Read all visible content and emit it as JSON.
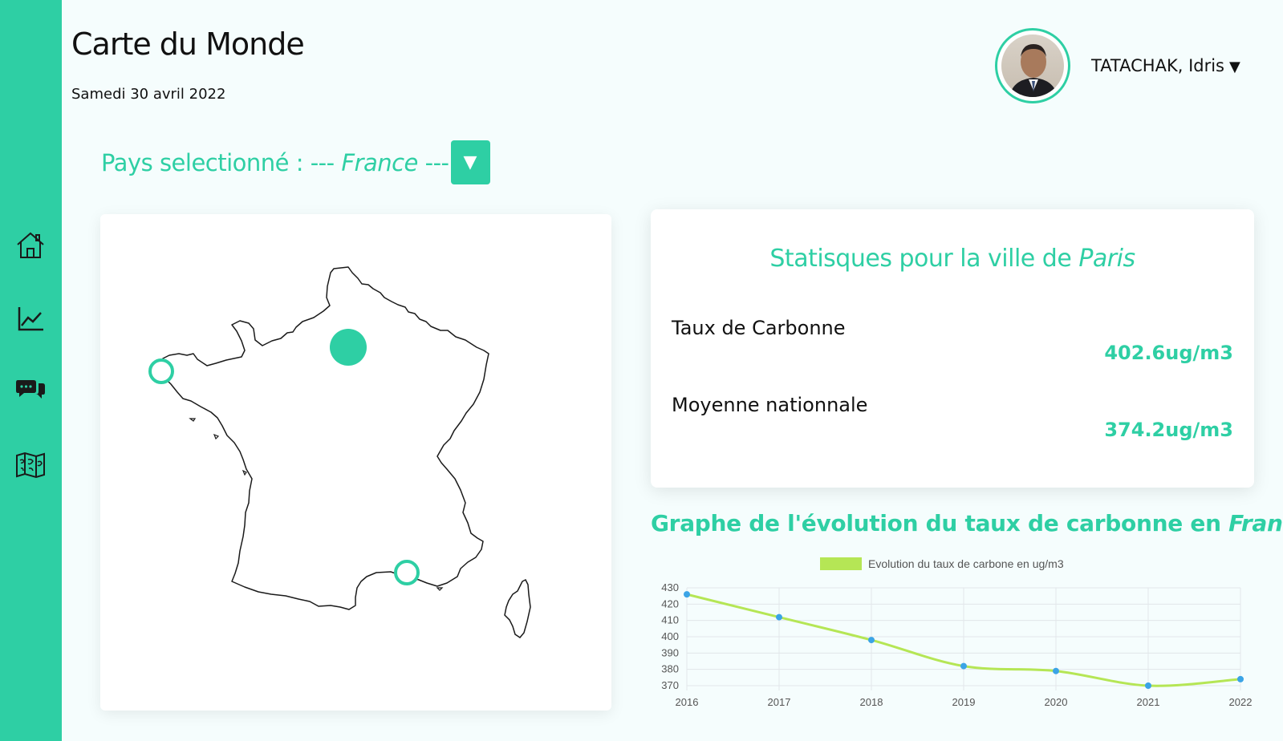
{
  "header": {
    "title": "Carte du Monde",
    "date": "Samedi 30 avril 2022"
  },
  "user": {
    "name": "TATACHAK, Idris",
    "caret": "▼"
  },
  "sidebar": {
    "items": [
      {
        "icon": "home-icon"
      },
      {
        "icon": "chart-line-icon"
      },
      {
        "icon": "chat-icon"
      },
      {
        "icon": "world-map-icon"
      }
    ]
  },
  "country_selector": {
    "label_prefix": "Pays selectionné : --- ",
    "country": "France",
    "label_suffix": " ---",
    "button_glyph": "▼"
  },
  "stats": {
    "title_prefix": "Statisques pour la ville de ",
    "city": "Paris",
    "carbon_label": "Taux de Carbonne",
    "carbon_value": "402.6ug/m3",
    "national_label": "Moyenne nationnale",
    "national_value": "374.2ug/m3"
  },
  "graph": {
    "title_prefix": "Graphe de l'évolution du taux de carbonne en ",
    "country": "France"
  },
  "colors": {
    "accent": "#2ecfa4",
    "line": "#b5e655",
    "point": "#3ba4e6"
  },
  "chart_data": {
    "type": "line",
    "x": [
      "2016",
      "2017",
      "2018",
      "2019",
      "2020",
      "2021",
      "2022"
    ],
    "series": [
      {
        "name": "Evolution du taux de carbone en ug/m3",
        "values": [
          426,
          412,
          398,
          382,
          379,
          370,
          374
        ]
      }
    ],
    "yticks": [
      370,
      380,
      390,
      400,
      410,
      420,
      430
    ],
    "ylim": [
      370,
      430
    ],
    "grid": true,
    "legend": "top"
  }
}
